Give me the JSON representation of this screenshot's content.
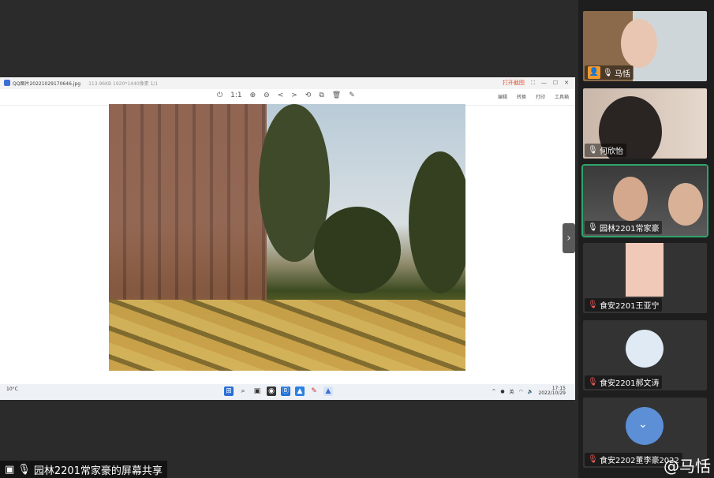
{
  "viewer": {
    "title": "QQ图片20221029170646.jpg",
    "meta": "113.96KB  1920*1440像素  1/1",
    "open_label": "打开截图",
    "tools": [
      "⏻",
      "1:1",
      "⊕",
      "⊖",
      "<",
      ">",
      "⟲",
      "⧉",
      "🗑",
      "✎"
    ],
    "right_tools": [
      "编辑",
      "转换",
      "打印",
      "工具箱"
    ]
  },
  "taskbar": {
    "weather": "10°C",
    "time": "17:15",
    "date": "2022/10/29",
    "lang": "英"
  },
  "share_label": "园林2201常家豪的屏幕共享",
  "participants": [
    {
      "name": "马恬",
      "muted": false
    },
    {
      "name": "何欣怡",
      "muted": false
    },
    {
      "name": "园林2201常家豪",
      "muted": false
    },
    {
      "name": "食安2201王亚宁",
      "muted": true
    },
    {
      "name": "食安2201郝文涛",
      "muted": true
    },
    {
      "name": "食安2202董李豪2022",
      "muted": true
    }
  ],
  "watermark": "@马恬",
  "colors": {
    "active_border": "#2fa56b",
    "muted": "#ff5c5c",
    "bg": "#2b2b2b"
  }
}
